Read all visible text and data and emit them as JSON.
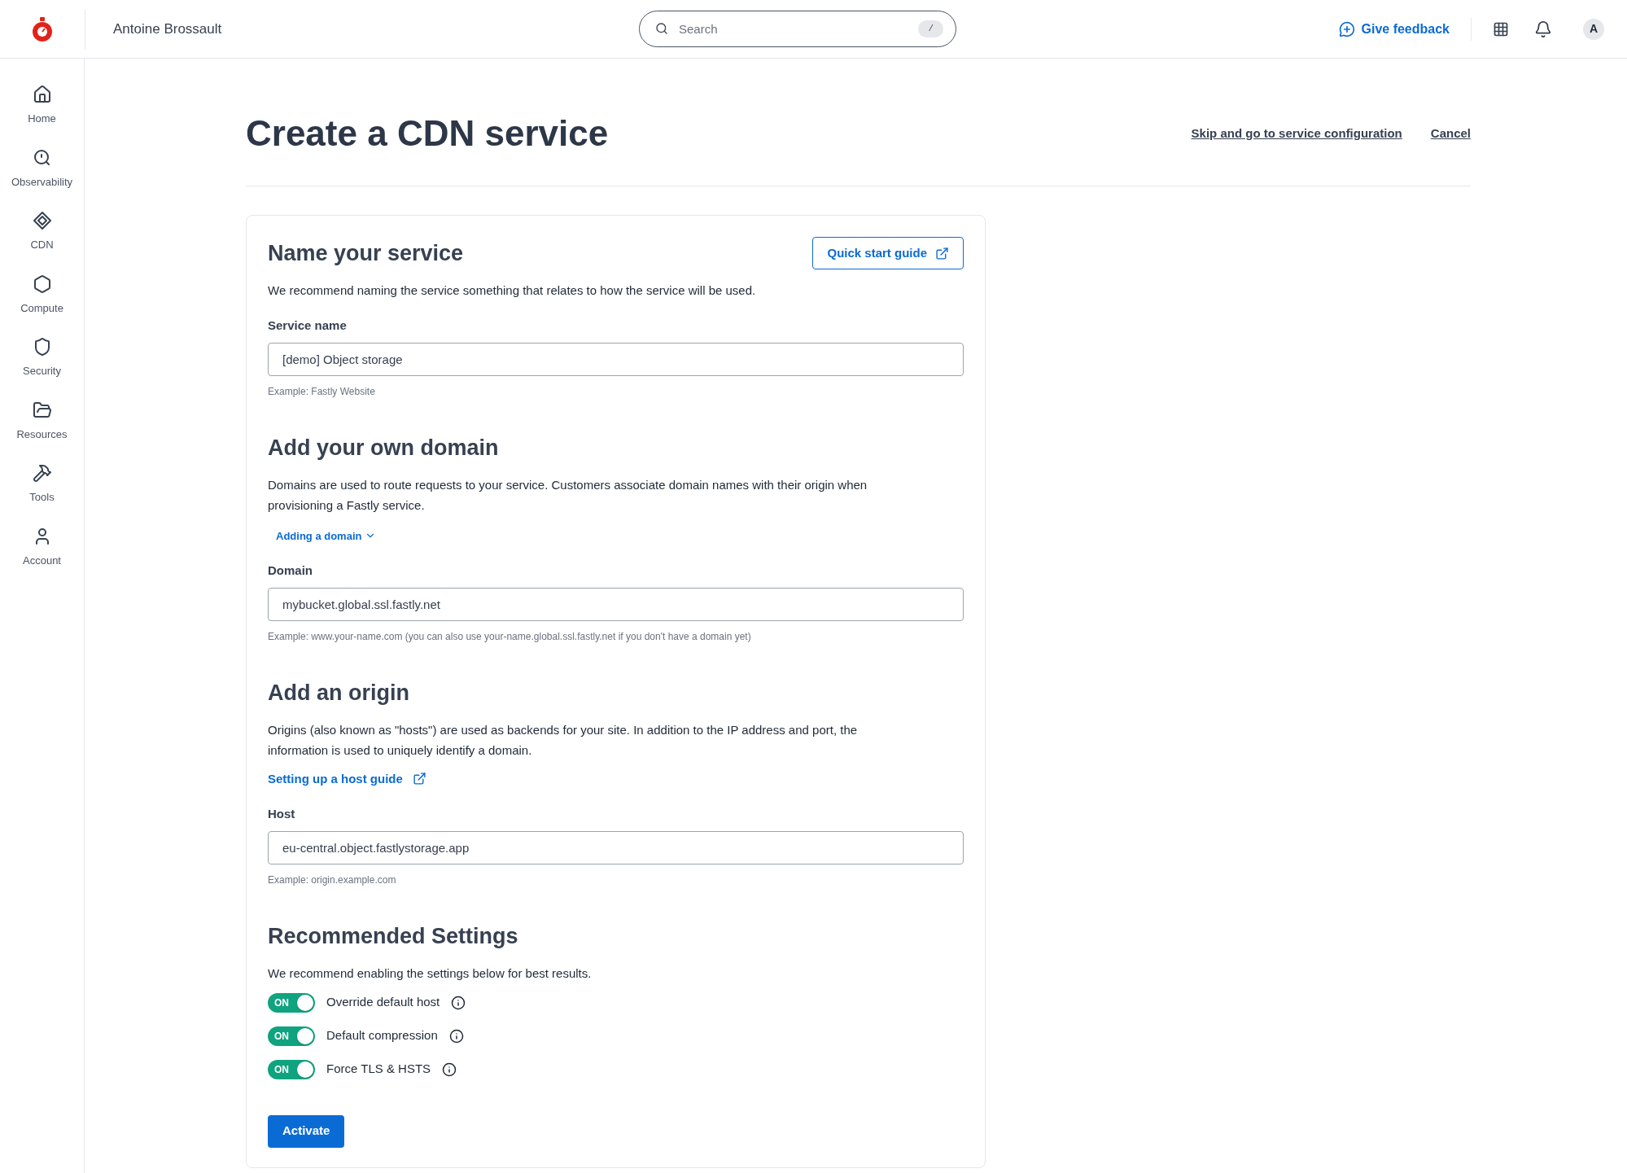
{
  "topbar": {
    "account_name": "Antoine Brossault",
    "search": {
      "placeholder": "Search",
      "shortcut": "/"
    },
    "feedback": "Give feedback",
    "avatar": "A"
  },
  "sidebar": {
    "items": [
      {
        "label": "Home"
      },
      {
        "label": "Observability"
      },
      {
        "label": "CDN"
      },
      {
        "label": "Compute"
      },
      {
        "label": "Security"
      },
      {
        "label": "Resources"
      },
      {
        "label": "Tools"
      },
      {
        "label": "Account"
      }
    ]
  },
  "page": {
    "title": "Create a CDN service",
    "skip_link": "Skip and go to service configuration",
    "cancel_link": "Cancel"
  },
  "sections": [
    {
      "title": "Name your service",
      "button": "Quick start guide",
      "description": "We recommend naming the service something that relates to how the service will be used.",
      "field": {
        "label": "Service name",
        "value": "[demo] Object storage",
        "hint": "Example: Fastly Website"
      }
    },
    {
      "title": "Add your own domain",
      "description": "Domains are used to route requests to your service. Customers associate domain names with their origin when provisioning a Fastly service.",
      "link": {
        "label": "Adding a domain",
        "kind": "disclosure"
      },
      "field": {
        "label": "Domain",
        "value": "mybucket.global.ssl.fastly.net",
        "hint": "Example: www.your-name.com (you can also use your-name.global.ssl.fastly.net if you don't have a domain yet)"
      }
    },
    {
      "title": "Add an origin",
      "description": "Origins (also known as \"hosts\") are used as backends for your site. In addition to the IP address and port, the information is used to uniquely identify a domain.",
      "link": {
        "label": "Setting up a host guide",
        "kind": "external"
      },
      "field": {
        "label": "Host",
        "value": "eu-central.object.fastlystorage.app",
        "hint": "Example: origin.example.com"
      }
    },
    {
      "title": "Recommended Settings",
      "description": "We recommend enabling the settings below for best results.",
      "toggles": [
        {
          "label": "Override default host",
          "on": true,
          "state_text": "ON"
        },
        {
          "label": "Default compression",
          "on": true,
          "state_text": "ON"
        },
        {
          "label": "Force TLS & HSTS",
          "on": true,
          "state_text": "ON"
        }
      ]
    }
  ],
  "submit": "Activate"
}
